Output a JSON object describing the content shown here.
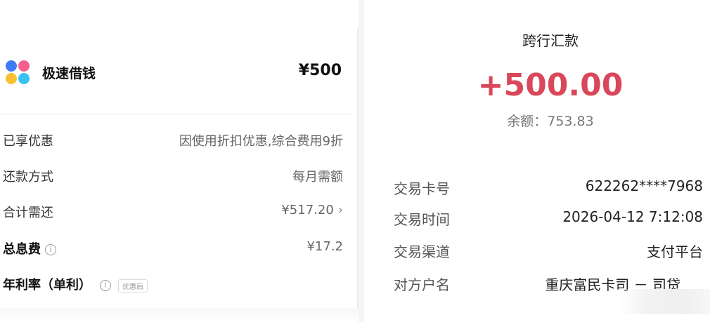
{
  "loan": {
    "product_name": "极速借钱",
    "amount": "¥500",
    "logo_icon": "four-dots-logo",
    "rows": [
      {
        "label": "已享优惠",
        "value": "因使用折扣优惠,综合费用9折"
      },
      {
        "label": "还款方式",
        "value": "每月需额"
      },
      {
        "label": "合计需还",
        "value": "¥517.20"
      },
      {
        "label": "总息费",
        "value": "¥17.2"
      },
      {
        "label": "年利率（单利）",
        "tag": "优惠后"
      }
    ]
  },
  "transfer": {
    "title": "跨行汇款",
    "amount": "+500.00",
    "amount_color": "#d9475a",
    "balance": "余额：753.83",
    "details": [
      {
        "label": "交易卡号",
        "value": "622262****7968"
      },
      {
        "label": "交易时间",
        "value": "2026-04-12 7:12:08"
      },
      {
        "label": "交易渠道",
        "value": "支付平台"
      },
      {
        "label": "对方户名",
        "value": "重庆富民卡司 － 司贷"
      }
    ]
  }
}
